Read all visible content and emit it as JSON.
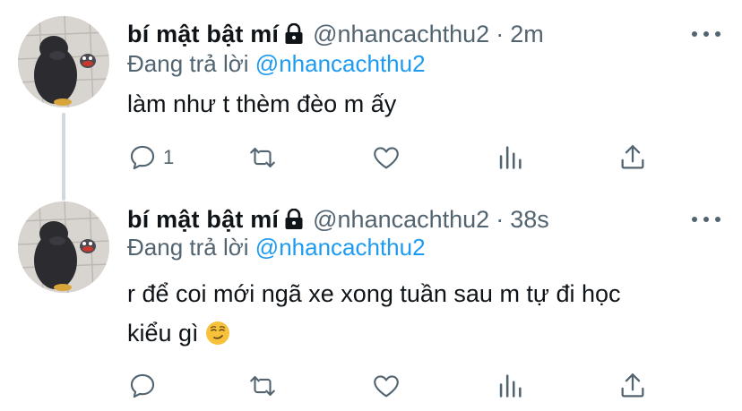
{
  "tweets": [
    {
      "display_name": "bí mật bật mí",
      "handle": "@nhancachthu2",
      "separator": "·",
      "time": "2m",
      "reply_prefix": "Đang trả lời",
      "reply_to": "@nhancachthu2",
      "text_lines": [
        "làm như t thèm đèo m ấy"
      ],
      "reply_count": "1",
      "protected_icon": "lock-icon",
      "emoji": null
    },
    {
      "display_name": "bí mật bật mí",
      "handle": "@nhancachthu2",
      "separator": "·",
      "time": "38s",
      "reply_prefix": "Đang trả lời",
      "reply_to": "@nhancachthu2",
      "text_lines": [
        "r để coi mới ngã xe xong tuần sau m tự đi học",
        "kiểu gì"
      ],
      "reply_count": "",
      "protected_icon": "lock-icon",
      "emoji": "smirking-face"
    }
  ],
  "icons": {
    "reply": "reply-icon",
    "retweet": "retweet-icon",
    "like": "like-icon",
    "views": "views-icon",
    "share": "share-icon",
    "more": "more-icon"
  },
  "colors": {
    "link": "#1d9bf0",
    "secondary_text": "#536471",
    "primary_text": "#0f1419",
    "thread_line": "#cfd9de"
  }
}
